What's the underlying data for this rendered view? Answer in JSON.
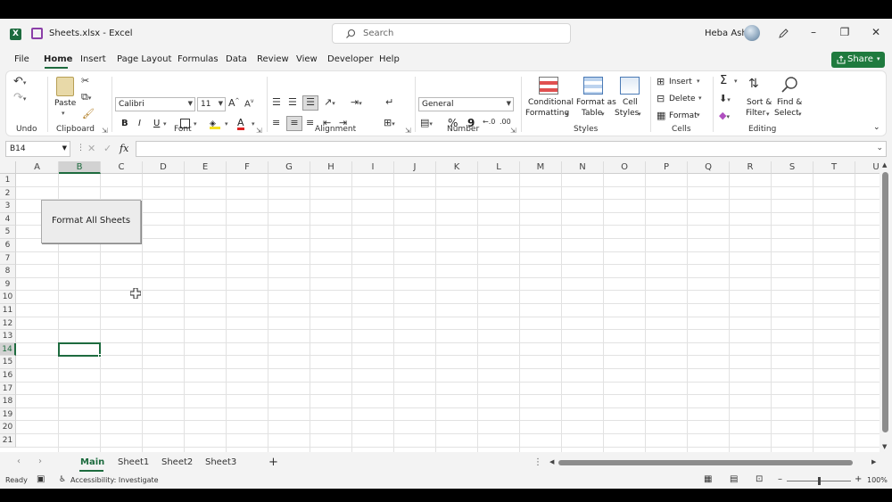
{
  "window": {
    "file_name": "Sheets.xlsx",
    "app_name": "Excel",
    "title_separator": " - ",
    "search_placeholder": "Search",
    "user_name": "Heba Ash"
  },
  "menu": {
    "items": [
      "File",
      "Home",
      "Insert",
      "Page Layout",
      "Formulas",
      "Data",
      "Review",
      "View",
      "Developer",
      "Help"
    ],
    "active": "Home",
    "share_label": "Share"
  },
  "ribbon": {
    "groups": {
      "undo": "Undo",
      "clipboard": "Clipboard",
      "font": "Font",
      "alignment": "Alignment",
      "number": "Number",
      "styles": "Styles",
      "cells": "Cells",
      "editing": "Editing"
    },
    "paste_label": "Paste",
    "font_name": "Calibri",
    "font_size": "11",
    "number_format": "General",
    "conditional_formatting": [
      "Conditional",
      "Formatting"
    ],
    "format_as_table": [
      "Format as",
      "Table"
    ],
    "cell_styles": [
      "Cell",
      "Styles"
    ],
    "insert_label": "Insert",
    "delete_label": "Delete",
    "format_label": "Format",
    "sort_filter": [
      "Sort &",
      "Filter"
    ],
    "find_select": [
      "Find &",
      "Select"
    ],
    "bold": "B",
    "italic": "I",
    "underline": "U",
    "percent": "%",
    "comma": "9",
    "sum": "Σ",
    "fx": "fx"
  },
  "formula_bar": {
    "name_box": "B14",
    "formula": ""
  },
  "grid": {
    "columns": [
      "A",
      "B",
      "C",
      "D",
      "E",
      "F",
      "G",
      "H",
      "I",
      "J",
      "K",
      "L",
      "M",
      "N",
      "O",
      "P",
      "Q",
      "R",
      "S",
      "T",
      "U"
    ],
    "rows": [
      "1",
      "2",
      "3",
      "4",
      "5",
      "6",
      "7",
      "8",
      "9",
      "10",
      "11",
      "12",
      "13",
      "14",
      "15",
      "16",
      "17",
      "18",
      "19",
      "20",
      "21"
    ],
    "selected_column": "B",
    "selected_row": "14",
    "macro_button_label": "Format All Sheets"
  },
  "sheets": {
    "tabs": [
      "Main",
      "Sheet1",
      "Sheet2",
      "Sheet3"
    ],
    "active": "Main",
    "add_label": "+"
  },
  "status": {
    "ready": "Ready",
    "accessibility": "Accessibility: Investigate",
    "zoom": "100%"
  },
  "colors": {
    "excel_green": "#1d6b3e",
    "share_green": "#1f7a3e",
    "word_purple": "#8b3fa8"
  },
  "icons": {
    "app": "excel-logo-icon",
    "save": "save-icon",
    "search": "search-icon",
    "pen": "pen-icon",
    "minimize": "minimize-icon",
    "restore": "restore-icon",
    "close": "close-icon"
  }
}
